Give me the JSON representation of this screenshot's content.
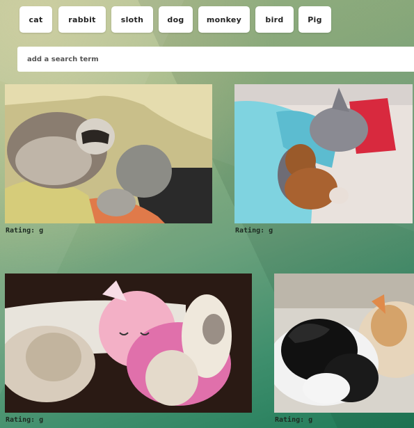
{
  "topics": [
    {
      "label": "cat"
    },
    {
      "label": "rabbit"
    },
    {
      "label": "sloth"
    },
    {
      "label": "dog"
    },
    {
      "label": "monkey"
    },
    {
      "label": "bird"
    },
    {
      "label": "Pig"
    }
  ],
  "search": {
    "placeholder": "add a search term",
    "value": ""
  },
  "results": [
    {
      "rating_text": "Rating: g"
    },
    {
      "rating_text": "Rating: g"
    },
    {
      "rating_text": "Rating: g"
    },
    {
      "rating_text": "Rating: g"
    }
  ]
}
